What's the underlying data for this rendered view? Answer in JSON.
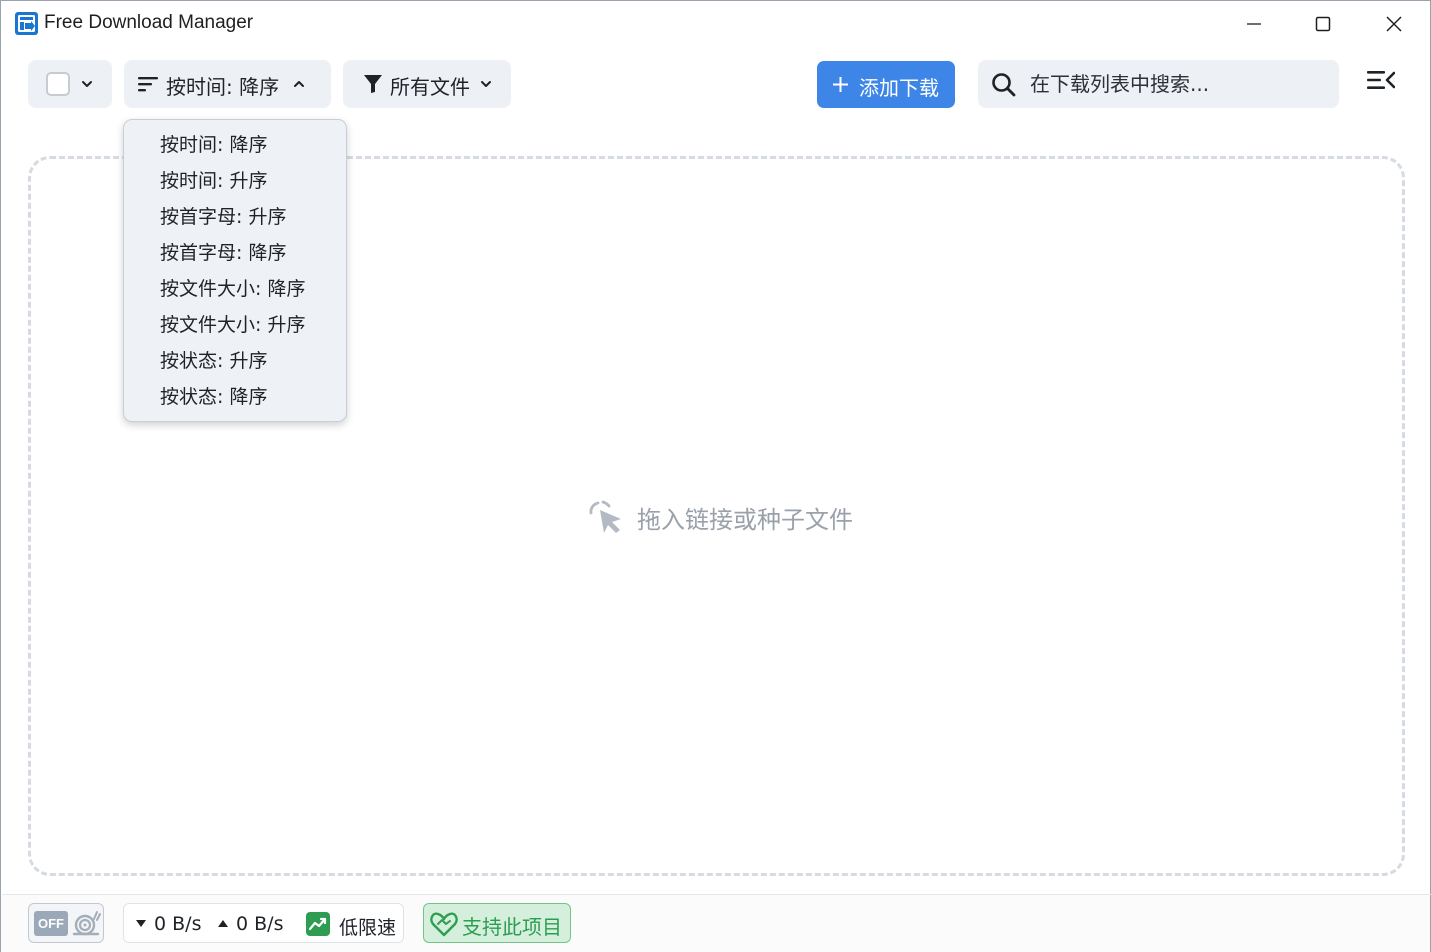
{
  "window": {
    "title": "Free Download Manager"
  },
  "toolbar": {
    "sort_label": "按时间: 降序",
    "filter_label": "所有文件",
    "add_label": "添加下载",
    "search_placeholder": "在下载列表中搜索..."
  },
  "sort_menu": {
    "items": [
      "按时间: 降序",
      "按时间: 升序",
      "按首字母: 升序",
      "按首字母: 降序",
      "按文件大小: 降序",
      "按文件大小: 升序",
      "按状态: 升序",
      "按状态: 降序"
    ]
  },
  "dropzone": {
    "hint": "拖入链接或种子文件"
  },
  "statusbar": {
    "snail_toggle": "OFF",
    "download_speed": "0 B/s",
    "upload_speed": "0 B/s",
    "speed_limit_label": "低限速",
    "support_label": "支持此项目"
  },
  "icons": {
    "logo": "fdm-logo-icon",
    "minimize": "minimize-icon",
    "maximize": "maximize-icon",
    "close": "close-icon",
    "sort": "sort-icon",
    "filter": "filter-icon",
    "plus": "plus-icon",
    "search": "search-icon",
    "menu": "menu-collapse-icon",
    "cursor": "cursor-click-icon",
    "snail": "snail-icon",
    "speed_limit": "trend-chart-icon",
    "heart": "heart-handshake-icon"
  },
  "colors": {
    "accent": "#3d86e8",
    "toolbar_bg": "#edf0f4",
    "support_bg": "#d4efdc",
    "support_text": "#2e9d52",
    "speed_limit_green": "#2e9d52"
  }
}
